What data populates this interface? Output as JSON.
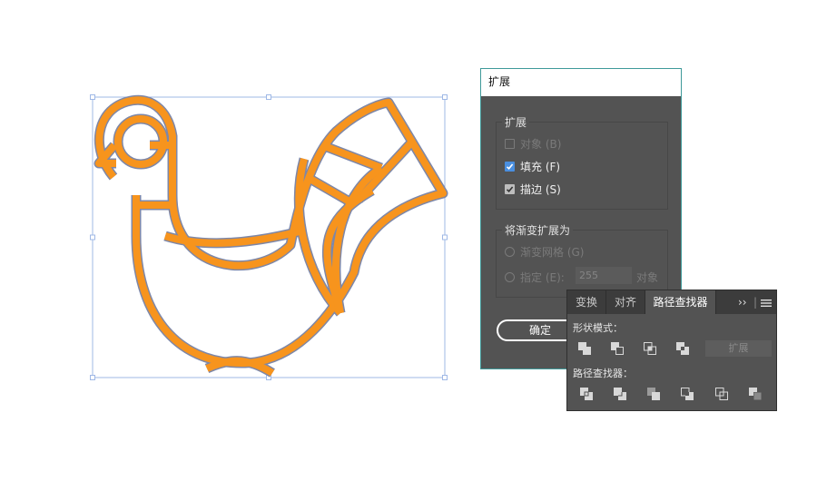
{
  "expand_dialog": {
    "title": "扩展",
    "expand_group": {
      "title": "扩展",
      "object_label": "对象 (B)",
      "fill_label": "填充 (F)",
      "stroke_label": "描边 (S)"
    },
    "gradient_group": {
      "title": "将渐变扩展为",
      "gradient_mesh_label": "渐变网格 (G)",
      "specify_label": "指定 (E):",
      "specify_value": "255",
      "objects_label": "对象"
    },
    "ok_label": "确定"
  },
  "pathfinder_panel": {
    "tabs": [
      "变换",
      "对齐",
      "路径查找器"
    ],
    "more_label": "››",
    "menu_icon": "menu-lines-icon",
    "shape_modes_label": "形状模式：",
    "expand_label": "扩展",
    "pathfinders_label": "路径查找器：",
    "shape_mode_icons": [
      "unite-icon",
      "minus-front-icon",
      "intersect-icon",
      "exclude-icon"
    ],
    "pathfinder_icons": [
      "divide-icon",
      "trim-icon",
      "merge-icon",
      "crop-icon",
      "outline-icon",
      "minus-back-icon"
    ]
  },
  "colors": {
    "artwork_fill": "#f7941d",
    "artwork_stroke": "#7d87a8",
    "selection": "#9fb8e6",
    "checkbox_blue": "#4a8fe0",
    "panel_bg": "#535353"
  }
}
